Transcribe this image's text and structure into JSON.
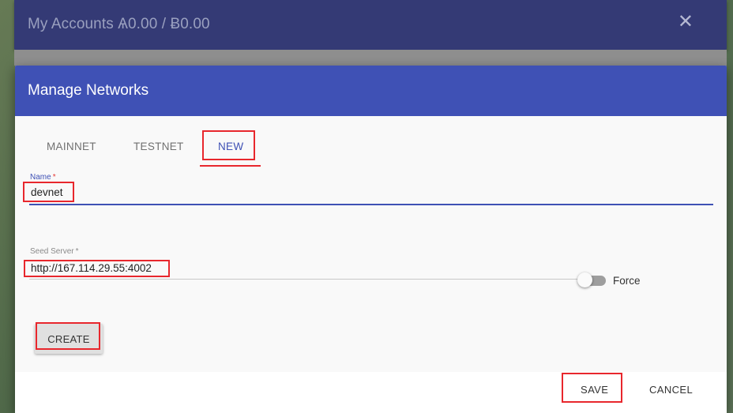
{
  "background": {
    "title": "My Accounts Ѧ0.00 / Ƀ0.00",
    "close_icon": "close-icon"
  },
  "dialog": {
    "title": "Manage Networks",
    "tabs": [
      {
        "label": "MAINNET",
        "active": false
      },
      {
        "label": "TESTNET",
        "active": false
      },
      {
        "label": "NEW",
        "active": true
      }
    ],
    "name_field": {
      "label": "Name",
      "required": "*",
      "value": "devnet"
    },
    "seed_field": {
      "label": "Seed Server",
      "required": "*",
      "value": "http://167.114.29.55:4002"
    },
    "force_toggle": {
      "label": "Force",
      "on": false
    },
    "create_label": "CREATE",
    "footer": {
      "save_label": "SAVE",
      "cancel_label": "CANCEL"
    }
  },
  "colors": {
    "primary": "#3f51b5",
    "header_bg_dimmed": "#343a75",
    "highlight": "#e8272d"
  }
}
